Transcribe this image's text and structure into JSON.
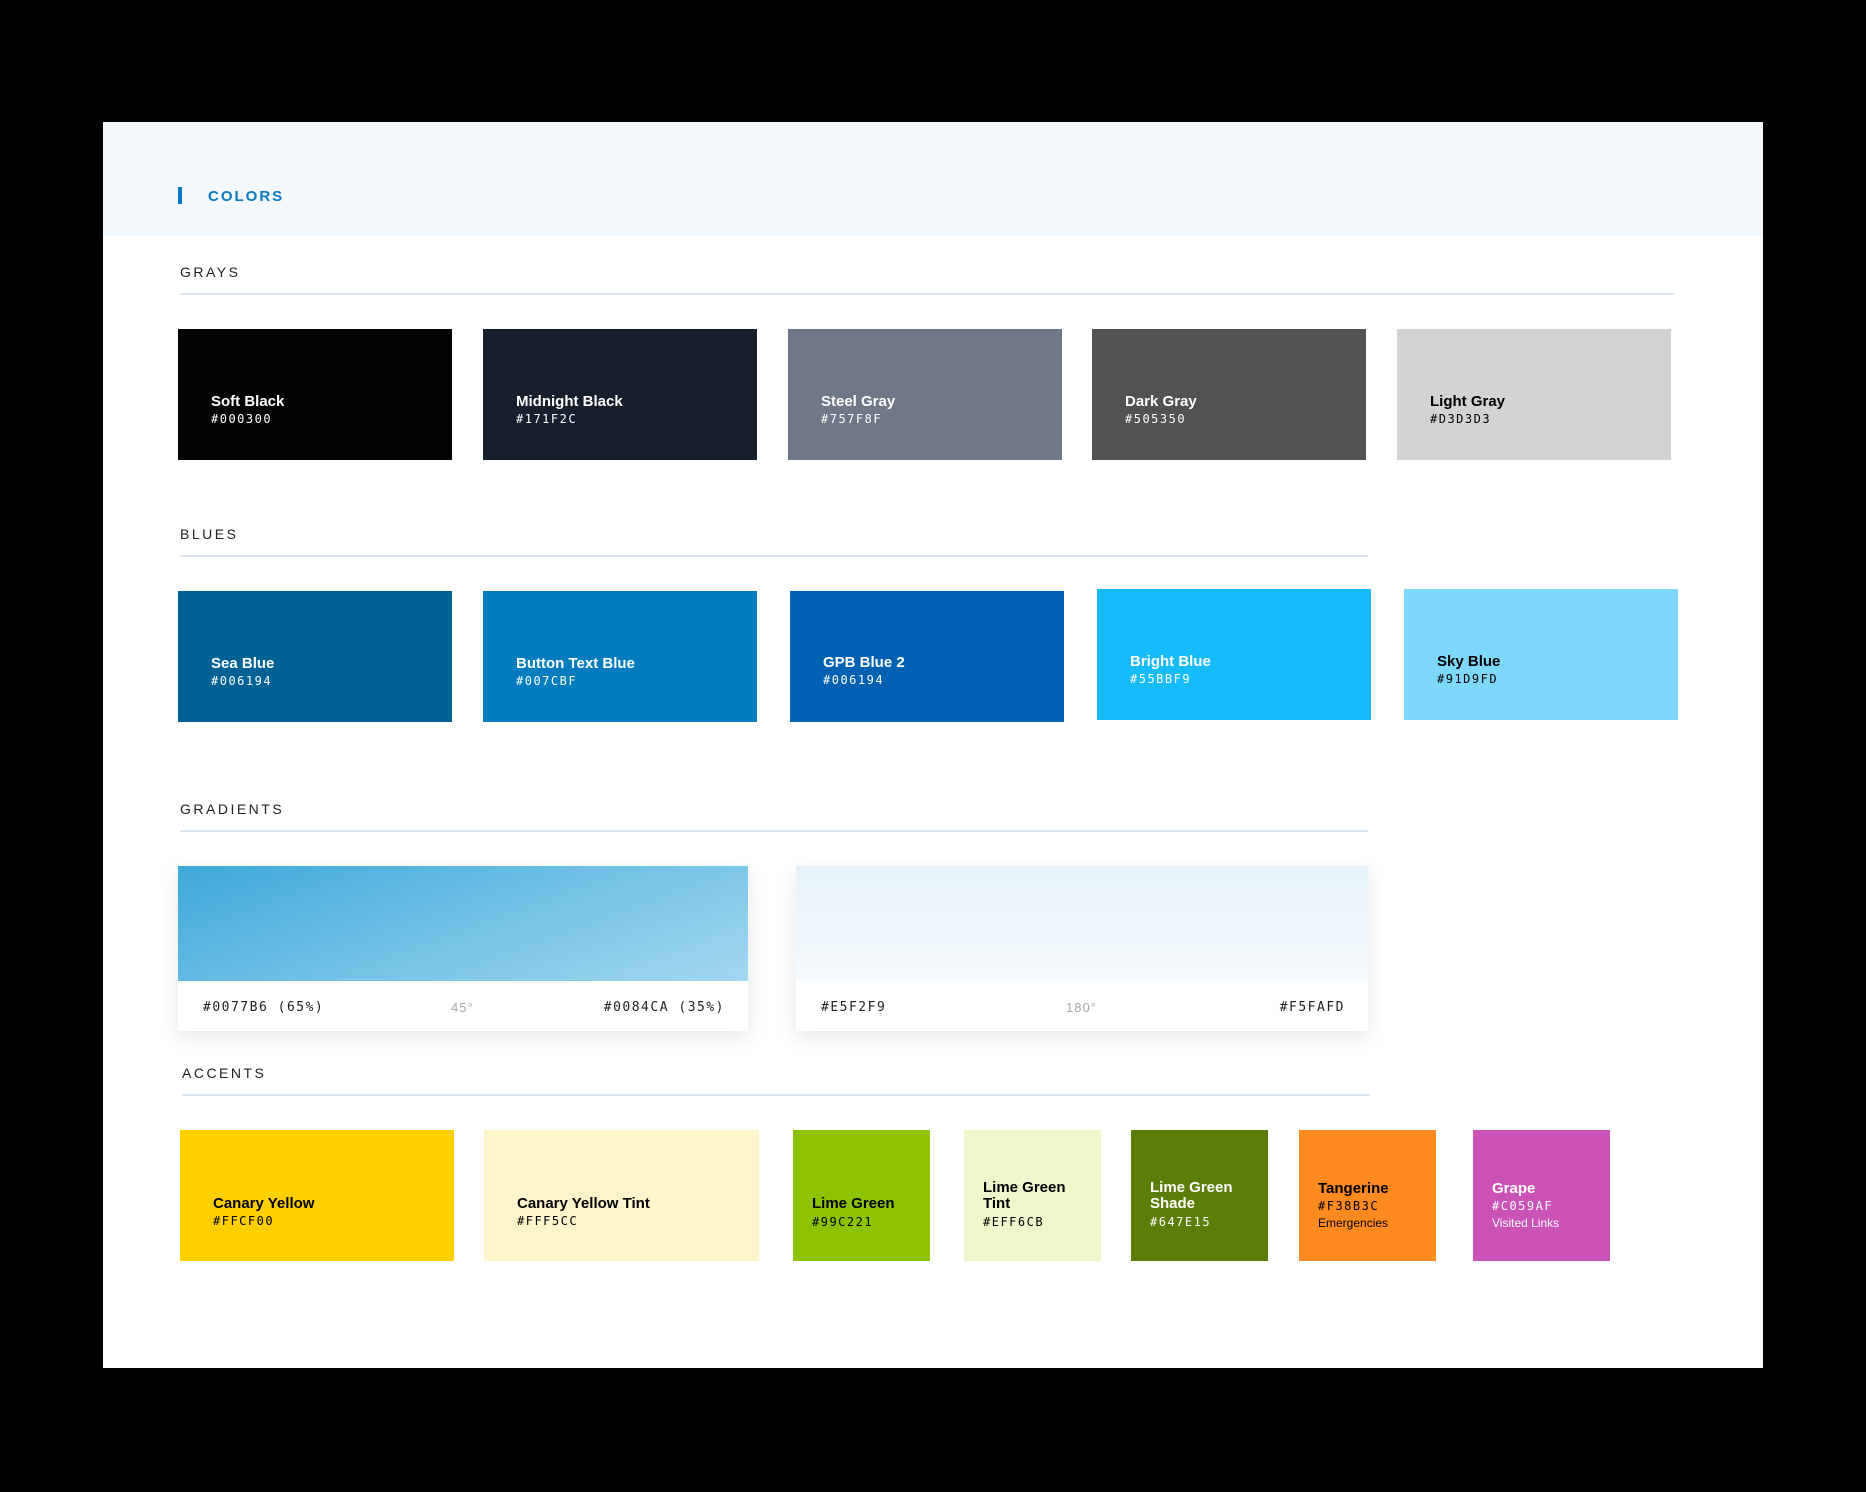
{
  "header": {
    "title": "COLORS"
  },
  "sections": {
    "grays": "GRAYS",
    "blues": "BLUES",
    "gradients": "GRADIENTS",
    "accents": "ACCENTS"
  },
  "grays": [
    {
      "name": "Soft Black",
      "hex": "#000300",
      "color": "#000300",
      "text_color": "#ffffff"
    },
    {
      "name": "Midnight Black",
      "hex": "#171F2C",
      "color": "#171F2C",
      "text_color": "#ffffff"
    },
    {
      "name": "Steel Gray",
      "hex": "#757F8F",
      "color": "#6E7889",
      "text_color": "#ffffff"
    },
    {
      "name": "Dark Gray",
      "hex": "#505350",
      "color": "#505350",
      "text_color": "#ffffff"
    },
    {
      "name": "Light Gray",
      "hex": "#D3D3D3",
      "color": "#D3D3D3",
      "text_color": "#000000"
    }
  ],
  "blues": [
    {
      "name": "Sea Blue",
      "hex": "#006194",
      "color": "#006194",
      "text_color": "#ffffff"
    },
    {
      "name": "Button Text Blue",
      "hex": "#007CBF",
      "color": "#007CBF",
      "text_color": "#ffffff"
    },
    {
      "name": "GPB Blue 2",
      "hex": "#006194",
      "color": "#0061B3",
      "text_color": "#ffffff"
    },
    {
      "name": "Bright Blue",
      "hex": "#55BBF9",
      "color": "#16BCFA",
      "text_color": "#ffffff"
    },
    {
      "name": "Sky Blue",
      "hex": "#91D9FD",
      "color": "#7DD8FC",
      "text_color": "#000000"
    }
  ],
  "gradients": [
    {
      "start": "#0077B6 (65%)",
      "angle": "45°",
      "end": "#0084CA (35%)",
      "from": "#3ea9d9",
      "to": "#a3d8f1"
    },
    {
      "start": "#E5F2F9",
      "angle": "180°",
      "end": "#F5FAFD",
      "from": "#e5f2f9",
      "to": "#f5fafd"
    }
  ],
  "accents": [
    {
      "name": "Canary Yellow",
      "hex": "#FFCF00",
      "note": "",
      "color": "#FFCF00",
      "text_color": "#000000"
    },
    {
      "name": "Canary Yellow Tint",
      "hex": "#FFF5CC",
      "note": "",
      "color": "#FFF5CC",
      "text_color": "#000000"
    },
    {
      "name": "Lime Green",
      "hex": "#99C221",
      "note": "",
      "color": "#8DC300",
      "text_color": "#000000"
    },
    {
      "name": "Lime Green\nTint",
      "hex": "#EFF6CB",
      "note": "",
      "color": "#EEF7CB",
      "text_color": "#000000"
    },
    {
      "name": "Lime Green\nShade",
      "hex": "#647E15",
      "note": "",
      "color": "#5B7E08",
      "text_color": "#ffffff"
    },
    {
      "name": "Tangerine",
      "hex": "#F38B3C",
      "note": "Emergencies",
      "color": "#FF8A1F",
      "text_color": "#000000"
    },
    {
      "name": "Grape",
      "hex": "#C059AF",
      "note": "Visited Links",
      "color": "#CB52B6",
      "text_color": "#ffffff"
    }
  ]
}
